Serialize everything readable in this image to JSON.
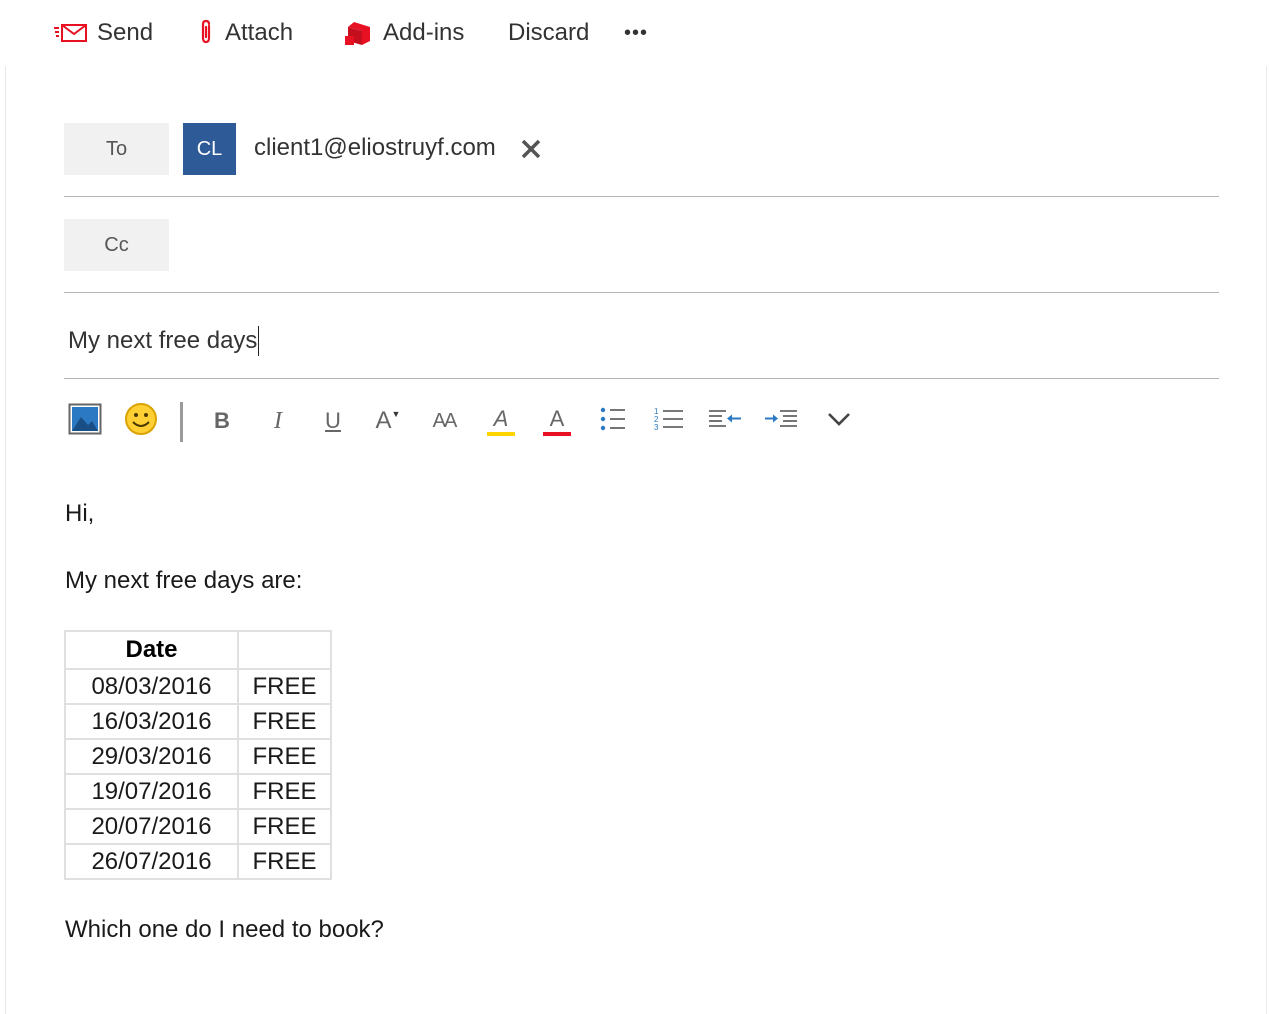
{
  "toolbar": {
    "send_label": "Send",
    "attach_label": "Attach",
    "addins_label": "Add-ins",
    "discard_label": "Discard",
    "more_label": "•••",
    "accent_color": "#e81123"
  },
  "header": {
    "to_label": "To",
    "cc_label": "Cc",
    "recipient_initials": "CL",
    "recipient_email": "client1@eliostruyf.com",
    "avatar_color": "#2e5a98",
    "subject": "My next free days"
  },
  "formatting": {
    "buttons": [
      "insert-picture",
      "emoji",
      "bold",
      "italic",
      "underline",
      "font-size",
      "font",
      "highlight",
      "font-color",
      "bullets",
      "numbering",
      "decrease-indent",
      "increase-indent",
      "more"
    ],
    "bold_glyph": "B",
    "italic_glyph": "I",
    "underline_glyph": "U",
    "font_size_glyph": "A",
    "font_glyph": "AA",
    "highlight_glyph": "A",
    "font_color_glyph": "A",
    "highlight_color": "#ffd500",
    "font_color": "#e81123"
  },
  "body": {
    "greeting": "Hi,",
    "intro": "My next free days are:",
    "table": {
      "headers": [
        "Date",
        ""
      ],
      "rows": [
        [
          "08/03/2016",
          "FREE"
        ],
        [
          "16/03/2016",
          "FREE"
        ],
        [
          "29/03/2016",
          "FREE"
        ],
        [
          "19/07/2016",
          "FREE"
        ],
        [
          "20/07/2016",
          "FREE"
        ],
        [
          "26/07/2016",
          "FREE"
        ]
      ]
    },
    "question": "Which one do I need to book?"
  }
}
